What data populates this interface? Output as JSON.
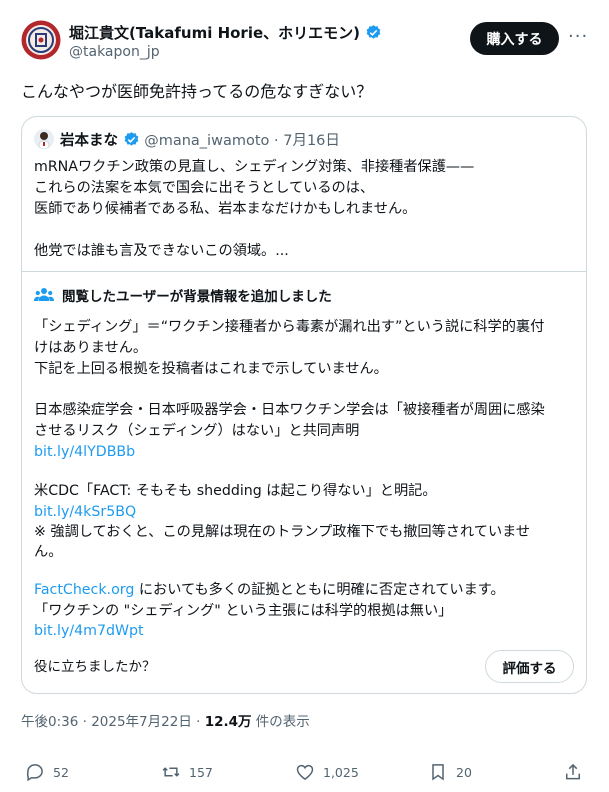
{
  "author": {
    "name": "堀江貴文(Takafumi Horie、ホリエモン)",
    "handle": "@takapon_jp",
    "buy_label": "購入する",
    "more_label": "···"
  },
  "post_text": "こんなやつが医師免許持ってるの危なすぎない？",
  "quote": {
    "name": "岩本まな",
    "handle": "@mana_iwamoto",
    "date": "· 7月16日",
    "lines": [
      "mRNAワクチン政策の見直し、シェディング対策、非接種者保護——",
      "これらの法案を本気で国会に出そうとしているのは、",
      "医師であり候補者である私、岩本まなだけかもしれません。",
      "",
      "他党では誰も言及できないこの領域。..."
    ]
  },
  "community_note": {
    "header": "閲覧したユーザーが背景情報を追加しました",
    "p1": [
      "「シェディング」＝“ワクチン接種者から毒素が漏れ出す”という説に科学的裏付",
      "けはありません。",
      "下記を上回る根拠を投稿者はこれまで示していません。"
    ],
    "p2": [
      "日本感染症学会・日本呼吸器学会・日本ワクチン学会は「被接種者が周囲に感染",
      "させるリスク（シェディング）はない」と共同声明"
    ],
    "link1": "bit.ly/4lYDBBb",
    "p3": [
      "米CDC「FACT: そもそも shedding は起こり得ない」と明記。"
    ],
    "link2": "bit.ly/4kSr5BQ",
    "p4": [
      "※ 強調しておくと、この見解は現在のトランプ政権下でも撤回等されていませ",
      "ん。"
    ],
    "factcheck_link": "FactCheck.org",
    "factcheck_rest": " においても多くの証拠とともに明確に否定されています。",
    "p5": [
      "「ワクチンの \"シェディング\" という主張には科学的根拠は無い」"
    ],
    "link3": "bit.ly/4m7dWpt",
    "helpful_q": "役に立ちましたか？",
    "rate_label": "評価する"
  },
  "meta": {
    "time": "午後0:36 · 2025年7月22日 · ",
    "views_count": "12.4万",
    "views_label": " 件の表示"
  },
  "actions": {
    "replies": "52",
    "reposts": "157",
    "likes": "1,025",
    "bookmarks": "20"
  },
  "colors": {
    "link": "#1d9bf0",
    "verified": "#1d9bf0",
    "text": "#0f1419",
    "muted": "#536471",
    "border": "#cfd9de"
  },
  "icons": [
    "verified-badge-icon",
    "people-icon",
    "reply-icon",
    "repost-icon",
    "like-icon",
    "bookmark-icon",
    "share-icon"
  ]
}
